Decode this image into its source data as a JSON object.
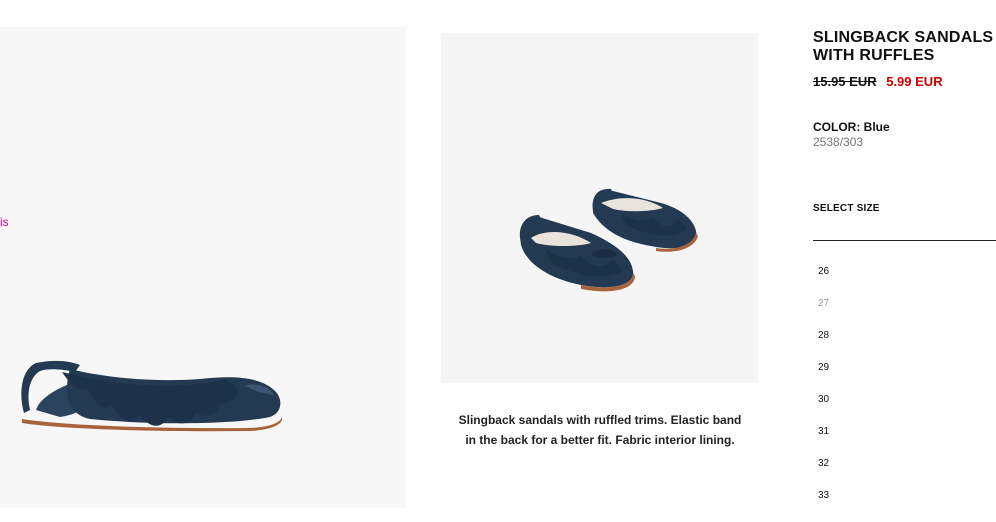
{
  "main_image": {
    "side_text": "is"
  },
  "product": {
    "title": "SLINGBACK SANDALS WITH RUFFLES",
    "old_price": "15.95 EUR",
    "new_price": "5.99 EUR",
    "color_label": "COLOR:",
    "color_value": "Blue",
    "ref": "2538/303",
    "select_size_label": "SELECT SIZE",
    "description": "Slingback sandals with ruffled trims. Elastic band in the back for a better fit. Fabric interior lining."
  },
  "sizes": [
    {
      "label": "26",
      "available": true
    },
    {
      "label": "27",
      "available": false
    },
    {
      "label": "28",
      "available": true
    },
    {
      "label": "29",
      "available": true
    },
    {
      "label": "30",
      "available": true
    },
    {
      "label": "31",
      "available": true
    },
    {
      "label": "32",
      "available": true
    },
    {
      "label": "33",
      "available": true
    }
  ],
  "colors": {
    "price_sale": "#cc0000",
    "accent_pink": "#e6007e",
    "shoe": "#233a52",
    "sole": "#a9633c"
  }
}
